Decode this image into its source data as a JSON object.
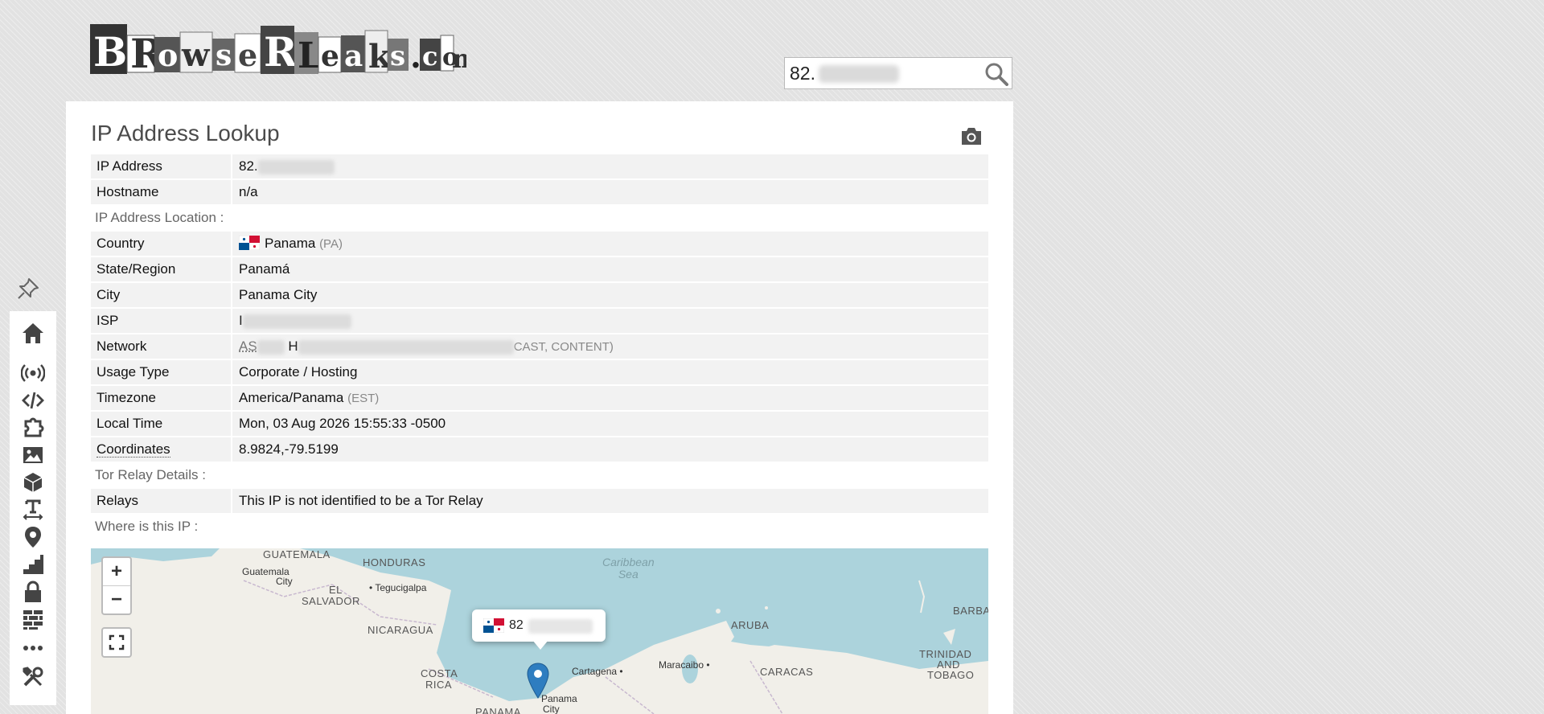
{
  "site": {
    "logo_text": "BrowserLeaks.com"
  },
  "search": {
    "value": "82.",
    "placeholder": ""
  },
  "page": {
    "title": "IP Address Lookup"
  },
  "sidebar": {
    "icons": [
      "pin-icon",
      "home-icon",
      "broadcast-icon",
      "code-icon",
      "puzzle-icon",
      "image-icon",
      "cube-icon",
      "text-icon",
      "location-icon",
      "steps-icon",
      "lock-icon",
      "firewall-icon",
      "more-icon",
      "tools-icon"
    ]
  },
  "rows": {
    "ip": {
      "label": "IP Address",
      "value": "82."
    },
    "hostname": {
      "label": "Hostname",
      "value": "n/a"
    },
    "location_heading": "IP Address Location :",
    "country": {
      "label": "Country",
      "value": "Panama",
      "code": "(PA)"
    },
    "state": {
      "label": "State/Region",
      "value": "Panamá"
    },
    "city": {
      "label": "City",
      "value": "Panama City"
    },
    "isp": {
      "label": "ISP",
      "value": "I"
    },
    "network": {
      "label": "Network",
      "as": "AS",
      "prefix": "H",
      "suffix": "CAST, CONTENT)"
    },
    "usage": {
      "label": "Usage Type",
      "value": "Corporate / Hosting"
    },
    "timezone": {
      "label": "Timezone",
      "value": "America/Panama",
      "abbr": "(EST)"
    },
    "localtime": {
      "label": "Local Time",
      "value": "Mon, 03 Aug 2026 15:55:33 -0500"
    },
    "coords": {
      "label": "Coordinates",
      "value": "8.9824,-79.5199"
    },
    "tor_heading": "Tor Relay Details :",
    "relays": {
      "label": "Relays",
      "value": "This IP is not identified to be a Tor Relay"
    },
    "map_heading": "Where is this IP :"
  },
  "map": {
    "zoom_in": "+",
    "zoom_out": "−",
    "popup_text": "82",
    "countries": [
      "GUATEMALA",
      "HONDURAS",
      "EL",
      "SALVADOR",
      "NICARAGUA",
      "COSTA",
      "RICA",
      "PANAMA",
      "ARUBA",
      "CARACAS",
      "TRINIDAD",
      "AND",
      "TOBAGO",
      "BARBA"
    ],
    "cities": [
      "Guatemala",
      "City",
      "Tegucigalpa",
      "Cartagena",
      "Maracaibo",
      "Panama",
      "City"
    ],
    "sea": [
      "Caribbean",
      "Sea"
    ]
  },
  "colors": {
    "accent": "#2e7dc0",
    "row_bg": "#f2f2f2",
    "water": "#acd3dc",
    "land": "#f1efe9"
  }
}
